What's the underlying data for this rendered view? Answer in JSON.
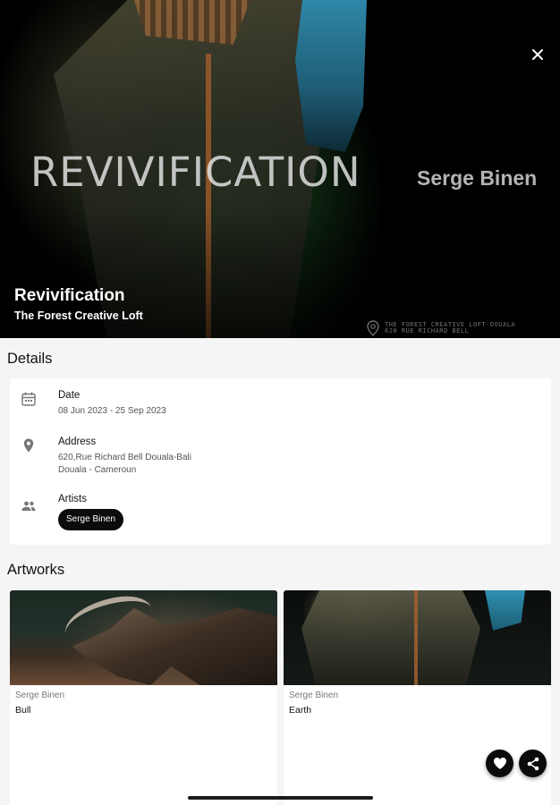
{
  "hero": {
    "poster_title": "REVIVIFICATION",
    "poster_artist": "Serge Binen",
    "title": "Revivification",
    "subtitle": "The Forest Creative Loft",
    "watermark_line1": "THE FOREST CREATIVE LOFT-DOUALA",
    "watermark_line2": "620 RUE RICHARD BELL"
  },
  "details": {
    "heading": "Details",
    "date": {
      "label": "Date",
      "value": "08 Jun 2023 - 25 Sep 2023",
      "icon": "calendar-icon"
    },
    "address": {
      "label": "Address",
      "line1": "620,Rue Richard Bell Douala-Bali",
      "line2": "Douala - Cameroun",
      "icon": "location-pin-icon"
    },
    "artists": {
      "label": "Artists",
      "chips": [
        "Serge Binen"
      ],
      "icon": "people-icon"
    }
  },
  "artworks": {
    "heading": "Artworks",
    "items": [
      {
        "artist": "Serge Binen",
        "title": "Bull"
      },
      {
        "artist": "Serge Binen",
        "title": "Earth"
      }
    ]
  },
  "colors": {
    "accent": "#0b0b0b",
    "background": "#f5f5f5",
    "card": "#ffffff"
  }
}
